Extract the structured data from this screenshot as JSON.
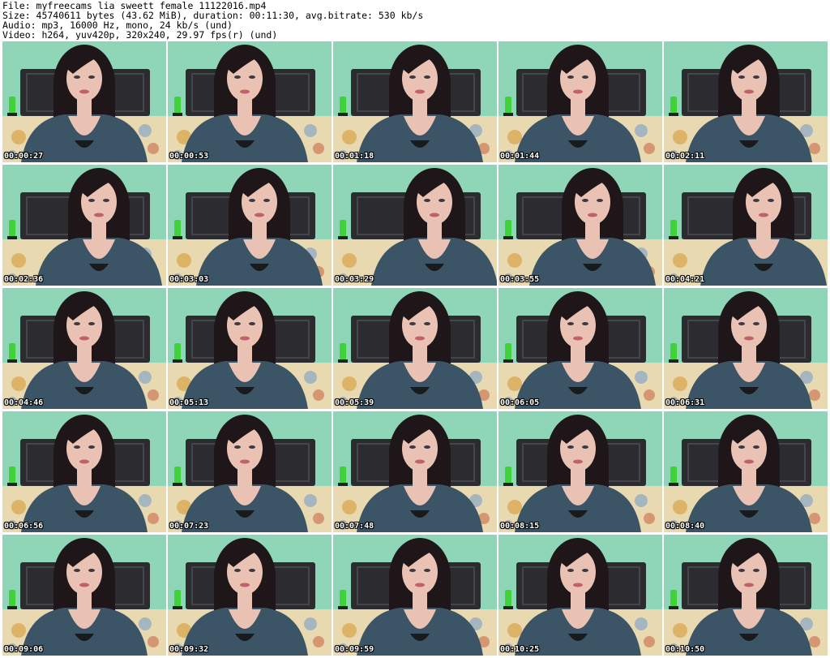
{
  "header": {
    "file_line": "File: myfreecams_lia_sweett_female_11122016.mp4",
    "size_line": "Size: 45740611 bytes (43.62 MiB), duration: 00:11:30, avg.bitrate: 530 kb/s",
    "audio_line": "Audio: mp3, 16000 Hz, mono, 24 kb/s (und)",
    "video_line": "Video: h264, yuv420p, 320x240, 29.97 fps(r) (und)"
  },
  "thumbnails": [
    {
      "timestamp": "00:00:27"
    },
    {
      "timestamp": "00:00:53"
    },
    {
      "timestamp": "00:01:18"
    },
    {
      "timestamp": "00:01:44"
    },
    {
      "timestamp": "00:02:11"
    },
    {
      "timestamp": "00:02:36"
    },
    {
      "timestamp": "00:03:03"
    },
    {
      "timestamp": "00:03:29"
    },
    {
      "timestamp": "00:03:55"
    },
    {
      "timestamp": "00:04:21"
    },
    {
      "timestamp": "00:04:46"
    },
    {
      "timestamp": "00:05:13"
    },
    {
      "timestamp": "00:05:39"
    },
    {
      "timestamp": "00:06:05"
    },
    {
      "timestamp": "00:06:31"
    },
    {
      "timestamp": "00:06:56"
    },
    {
      "timestamp": "00:07:23"
    },
    {
      "timestamp": "00:07:48"
    },
    {
      "timestamp": "00:08:15"
    },
    {
      "timestamp": "00:08:40"
    },
    {
      "timestamp": "00:09:06"
    },
    {
      "timestamp": "00:09:32"
    },
    {
      "timestamp": "00:09:59"
    },
    {
      "timestamp": "00:10:25"
    },
    {
      "timestamp": "00:10:50"
    }
  ],
  "colors": {
    "wall": "#8fd6b8",
    "headboard": "#2b2b30",
    "bedding": "#e8d9b0",
    "hair": "#1e1618",
    "skin": "#e9c2b3",
    "sweater": "#3c5566",
    "lamp": "#3fd23a"
  }
}
